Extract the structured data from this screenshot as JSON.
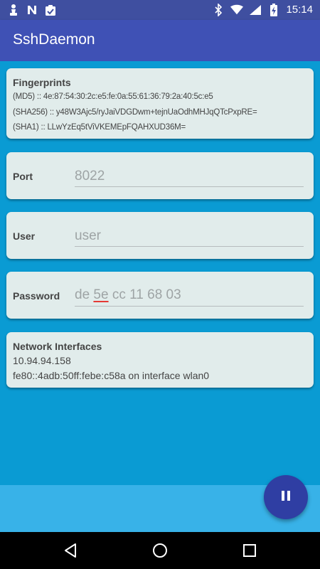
{
  "status_bar": {
    "time": "15:14",
    "left_icons": [
      "chess-pawn-icon",
      "n-app-icon",
      "clipboard-check-icon"
    ],
    "right_icons": [
      "bluetooth-icon",
      "wifi-icon",
      "signal-icon",
      "battery-charging-icon"
    ]
  },
  "app_bar": {
    "title": "SshDaemon"
  },
  "fingerprints": {
    "title": "Fingerprints",
    "md5": "(MD5) :: 4e:87:54:30:2c:e5:fe:0a:55:61:36:79:2a:40:5c:e5",
    "sha256": "(SHA256) :: y48W3Ajc5/ryJaiVDGDwm+tejnUaOdhMHJqQTcPxpRE=",
    "sha1": "(SHA1) :: LLwYzEq5tViVKEMEpFQAHXUD36M="
  },
  "port": {
    "label": "Port",
    "value": "8022"
  },
  "user": {
    "label": "User",
    "placeholder": "user"
  },
  "password": {
    "label": "Password",
    "value_before": "de ",
    "value_misspelled": "5e",
    "value_after": " cc 11 68 03"
  },
  "network": {
    "title": "Network Interfaces",
    "ipv4": "10.94.94.158",
    "ipv6": "fe80::4adb:50ff:febe:c58a on interface wlan0"
  },
  "fab": {
    "icon": "pause-icon"
  },
  "colors": {
    "app_bar": "#3f51b5",
    "status_bar": "#3f4fa0",
    "background": "#0a9bd3",
    "card": "#e1eceb",
    "fab": "#2f3ea3",
    "bottom_strip": "#38b2e8"
  },
  "nav_bar": {
    "icons": [
      "back-icon",
      "home-icon",
      "recents-icon"
    ]
  }
}
